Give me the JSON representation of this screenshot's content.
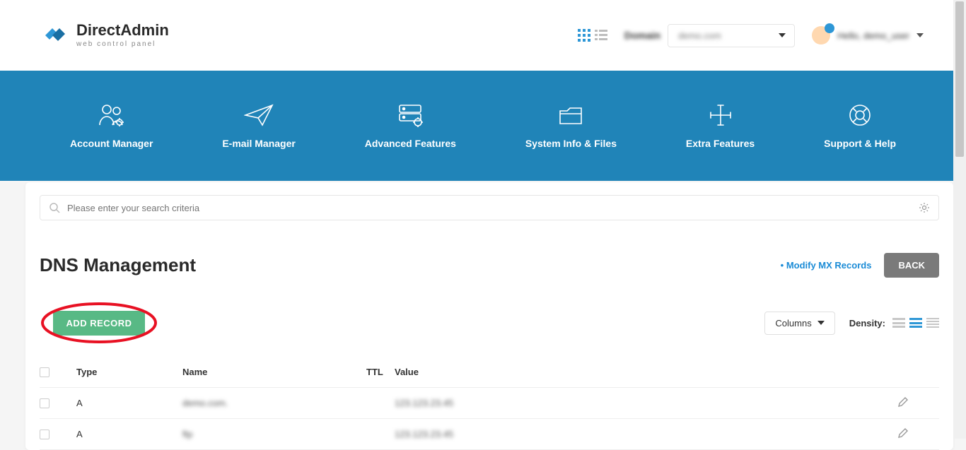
{
  "brand": {
    "name": "DirectAdmin",
    "tag": "web control panel"
  },
  "top": {
    "domain_label": "Domain",
    "domain_value": "demo.com",
    "user_greeting": "Hello, demo_user"
  },
  "nav": [
    {
      "label": "Account Manager"
    },
    {
      "label": "E-mail Manager"
    },
    {
      "label": "Advanced Features"
    },
    {
      "label": "System Info & Files"
    },
    {
      "label": "Extra Features"
    },
    {
      "label": "Support & Help"
    }
  ],
  "search": {
    "placeholder": "Please enter your search criteria"
  },
  "page": {
    "title": "DNS Management",
    "mx_link": "Modify MX Records",
    "back": "BACK",
    "add_record": "ADD RECORD",
    "columns": "Columns",
    "density": "Density:"
  },
  "table": {
    "headers": {
      "type": "Type",
      "name": "Name",
      "ttl": "TTL",
      "value": "Value"
    },
    "rows": [
      {
        "type": "A",
        "name": "demo.com.",
        "ttl": "",
        "value": "123.123.23.45"
      },
      {
        "type": "A",
        "name": "ftp",
        "ttl": "",
        "value": "123.123.23.45"
      }
    ]
  }
}
